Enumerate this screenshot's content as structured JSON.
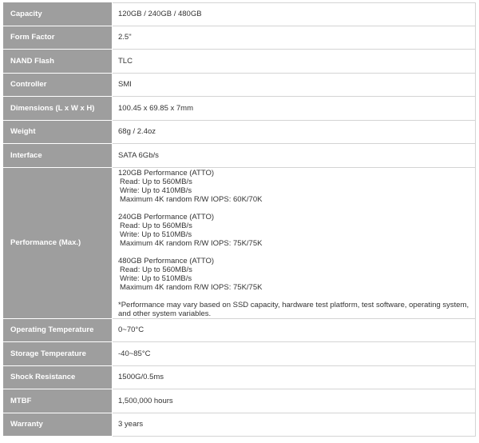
{
  "specs": {
    "capacity": {
      "label": "Capacity",
      "value": "120GB / 240GB / 480GB"
    },
    "form_factor": {
      "label": "Form Factor",
      "value": "2.5\""
    },
    "nand_flash": {
      "label": "NAND Flash",
      "value": "TLC"
    },
    "controller": {
      "label": "Controller",
      "value": "SMI"
    },
    "dimensions": {
      "label": "Dimensions (L x W x H)",
      "value": "100.45 x 69.85 x 7mm"
    },
    "weight": {
      "label": "Weight",
      "value": "68g / 2.4oz"
    },
    "interface": {
      "label": "Interface",
      "value": "SATA 6Gb/s"
    },
    "performance": {
      "label": "Performance (Max.)",
      "groups": [
        {
          "heading": "120GB Performance (ATTO)",
          "read": "Read: Up to 560MB/s",
          "write": "Write: Up to 410MB/s",
          "iops": "Maximum 4K random R/W IOPS: 60K/70K"
        },
        {
          "heading": "240GB Performance (ATTO)",
          "read": "Read: Up to 560MB/s",
          "write": "Write: Up to 510MB/s",
          "iops": "Maximum 4K random R/W IOPS: 75K/75K"
        },
        {
          "heading": "480GB Performance (ATTO)",
          "read": "Read: Up to 560MB/s",
          "write": "Write: Up to 510MB/s",
          "iops": "Maximum 4K random R/W IOPS: 75K/75K"
        }
      ],
      "note": "*Performance may vary based on SSD capacity, hardware test platform, test software, operating system, and other system variables."
    },
    "operating_temperature": {
      "label": "Operating Temperature",
      "value": "0~70°C"
    },
    "storage_temperature": {
      "label": "Storage Temperature",
      "value": "-40~85°C"
    },
    "shock_resistance": {
      "label": "Shock Resistance",
      "value": "1500G/0.5ms"
    },
    "mtbf": {
      "label": "MTBF",
      "value": "1,500,000 hours"
    },
    "warranty": {
      "label": "Warranty",
      "value": "3 years"
    }
  },
  "colors": {
    "label_background": "#9e9e9e",
    "label_text": "#ffffff",
    "value_text": "#333333",
    "border": "#d4d4d4"
  }
}
